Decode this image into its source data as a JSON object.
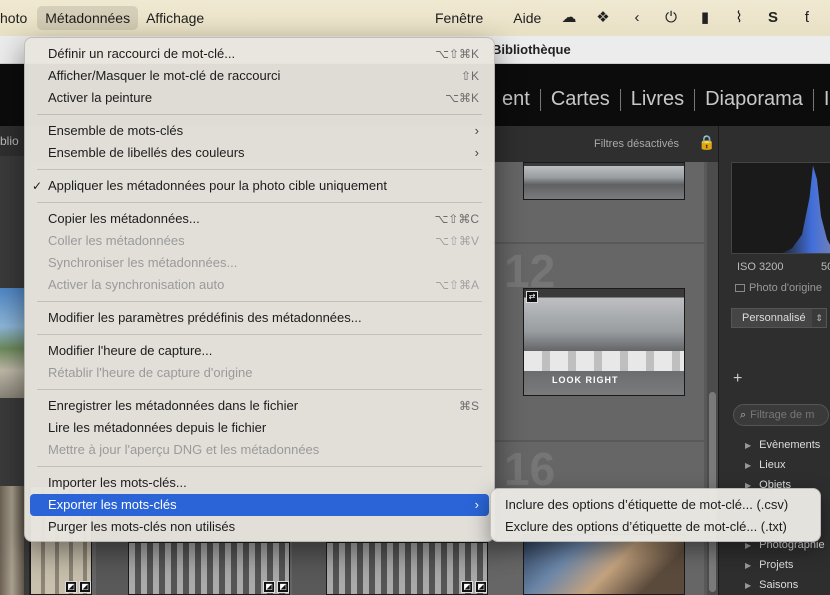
{
  "menubar": {
    "items": [
      "hoto",
      "Métadonnées",
      "Affichage"
    ],
    "right_items": [
      "Fenêtre",
      "Aide"
    ],
    "status_icons": [
      "cloud-icon",
      "dropbox-icon",
      "chevron-left-icon",
      "power-icon",
      "bookmark-icon",
      "paperclip-icon",
      "s-app-icon",
      "t-app-icon"
    ]
  },
  "window": {
    "title": "Bibliothèque"
  },
  "modules": [
    "ent",
    "Cartes",
    "Livres",
    "Diaporama",
    "I"
  ],
  "left_panel": {
    "header": "blio"
  },
  "grid": {
    "filter_label": "Filtres désactivés",
    "cell_numbers": [
      "12",
      "16"
    ],
    "photo_caption": "LOOK RIGHT"
  },
  "right_panel": {
    "iso": "ISO 3200",
    "iso_extra": "50",
    "original_photo": "Photo d'origine",
    "preset": "Personnalisé",
    "keyword_filter_placeholder": "Filtrage de m",
    "keywords": [
      "Evènements",
      "Lieux",
      "Objets",
      "Photographie",
      "Projets",
      "Saisons"
    ]
  },
  "menu": {
    "items": [
      {
        "label": "Définir un raccourci de mot-clé...",
        "shortcut": "⌥⇧⌘K"
      },
      {
        "label": "Afficher/Masquer le mot-clé de raccourci",
        "shortcut": "⇧K"
      },
      {
        "label": "Activer la peinture",
        "shortcut": "⌥⌘K"
      },
      {
        "label": "Ensemble de mots-clés",
        "shortcut": ""
      },
      {
        "label": "Ensemble de libellés des couleurs",
        "shortcut": ""
      },
      {
        "label": "Appliquer les métadonnées pour la photo cible uniquement",
        "shortcut": "",
        "checked": true
      },
      {
        "label": "Copier les métadonnées...",
        "shortcut": "⌥⇧⌘C"
      },
      {
        "label": "Coller les métadonnées",
        "shortcut": "⌥⇧⌘V",
        "disabled": true
      },
      {
        "label": "Synchroniser les métadonnées...",
        "shortcut": "",
        "disabled": true
      },
      {
        "label": "Activer la synchronisation auto",
        "shortcut": "⌥⇧⌘A",
        "disabled": true
      },
      {
        "label": "Modifier les paramètres prédéfinis des métadonnées...",
        "shortcut": ""
      },
      {
        "label": "Modifier l'heure de capture...",
        "shortcut": ""
      },
      {
        "label": "Rétablir l'heure de capture d'origine",
        "shortcut": "",
        "disabled": true
      },
      {
        "label": "Enregistrer les métadonnées dans le fichier",
        "shortcut": "⌘S"
      },
      {
        "label": "Lire les métadonnées depuis le fichier",
        "shortcut": ""
      },
      {
        "label": "Mettre à jour l'aperçu DNG et les métadonnées",
        "shortcut": "",
        "disabled": true
      },
      {
        "label": "Importer les mots-clés...",
        "shortcut": ""
      },
      {
        "label": "Exporter les mots-clés",
        "shortcut": "",
        "highlighted": true
      },
      {
        "label": "Purger les mots-clés non utilisés",
        "shortcut": ""
      }
    ],
    "submenu": [
      "Inclure des options d’étiquette de mot-clé... (.csv)",
      "Exclure des options d’étiquette de mot-clé... (.txt)"
    ]
  },
  "colors": {
    "highlight": "#2a64d6",
    "menubar": "#f0e9d2",
    "menu_bg": "#e8e5df"
  }
}
